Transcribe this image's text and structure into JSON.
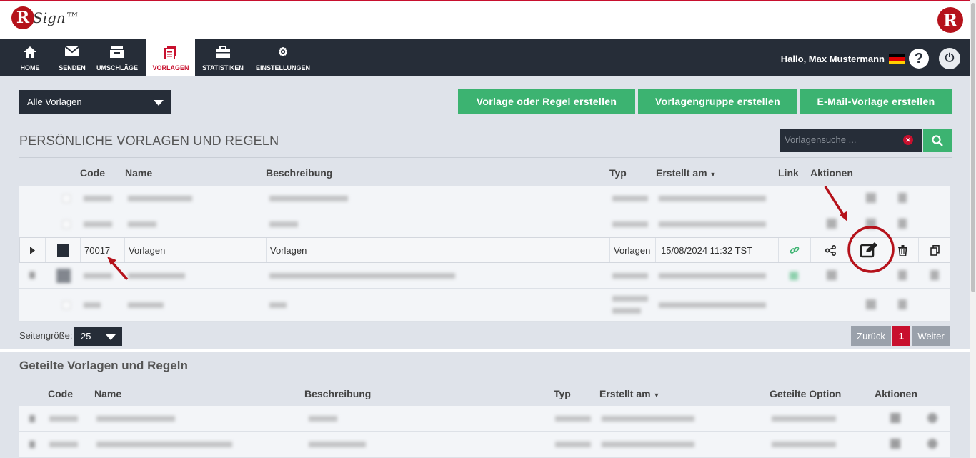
{
  "brand": {
    "logo_letter": "R",
    "logo_text": "Sign™",
    "right_logo_letter": "R"
  },
  "nav": {
    "items": [
      {
        "label": "HOME",
        "icon": "home-icon"
      },
      {
        "label": "SENDEN",
        "icon": "envelope-icon"
      },
      {
        "label": "UMSCHLÄGE",
        "icon": "envelopes-icon"
      },
      {
        "label": "VORLAGEN",
        "icon": "templates-icon"
      },
      {
        "label": "STATISTIKEN",
        "icon": "briefcase-icon"
      },
      {
        "label": "EINSTELLUNGEN",
        "icon": "gear-icon"
      }
    ],
    "greeting": "Hallo, Max Mustermann",
    "help_label": "?"
  },
  "filter": {
    "selected": "Alle Vorlagen"
  },
  "actions": {
    "create_template": "Vorlage oder Regel erstellen",
    "create_group": "Vorlagengruppe erstellen",
    "create_email": "E-Mail-Vorlage erstellen"
  },
  "personal": {
    "title": "PERSÖNLICHE VORLAGEN UND REGELN",
    "search_placeholder": "Vorlagensuche ...",
    "columns": {
      "code": "Code",
      "name": "Name",
      "description": "Beschreibung",
      "type": "Typ",
      "created": "Erstellt am",
      "link": "Link",
      "actions": "Aktionen"
    },
    "highlighted_row": {
      "code": "70017",
      "name": "Vorlagen",
      "description": "Vorlagen",
      "type": "Vorlagen",
      "created": "15/08/2024 11:32 TST"
    }
  },
  "pagination": {
    "page_size_label": "Seitengröße:",
    "page_size": "25",
    "prev": "Zurück",
    "current": "1",
    "next": "Weiter"
  },
  "shared": {
    "title": "Geteilte Vorlagen und Regeln",
    "columns": {
      "code": "Code",
      "name": "Name",
      "description": "Beschreibung",
      "type": "Typ",
      "created": "Erstellt am",
      "shared_option": "Geteilte Option",
      "actions": "Aktionen"
    }
  },
  "colors": {
    "accent_green": "#3cb371",
    "nav_dark": "#262d38",
    "brand_red": "#c8102e"
  }
}
